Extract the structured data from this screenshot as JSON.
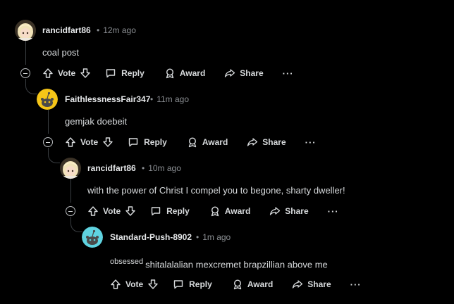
{
  "comments": [
    {
      "username": "rancidfart86",
      "time": "12m ago",
      "body": "coal post",
      "avatar": "anime-avatar"
    },
    {
      "username": "FaithlessnessFair347",
      "time": "11m ago",
      "body": "gemjak doebeit",
      "avatar": "snoo-avatar-yellow"
    },
    {
      "username": "rancidfart86",
      "time": "10m ago",
      "body": "with the power of Christ I compel you to begone, sharty dweller!",
      "avatar": "anime-avatar"
    },
    {
      "username": "Standard-Push-8902",
      "time": "1m ago",
      "flair": "obsessed",
      "body": "shitalalalian mexcremet brapzillian above me",
      "avatar": "snoo-avatar-cyan"
    }
  ],
  "actions": {
    "vote": "Vote",
    "reply": "Reply",
    "award": "Award",
    "share": "Share",
    "more": "···"
  },
  "colors": {
    "background": "#000000",
    "text": "#d7dadc",
    "muted": "#8b8f93",
    "thread_line": "#3a3e42",
    "snoo_yellow": "#f5c518",
    "snoo_cyan": "#5fd3e0"
  },
  "icons": [
    "collapse-icon",
    "upvote-icon",
    "downvote-icon",
    "reply-icon",
    "award-icon",
    "share-icon",
    "more-icon"
  ]
}
